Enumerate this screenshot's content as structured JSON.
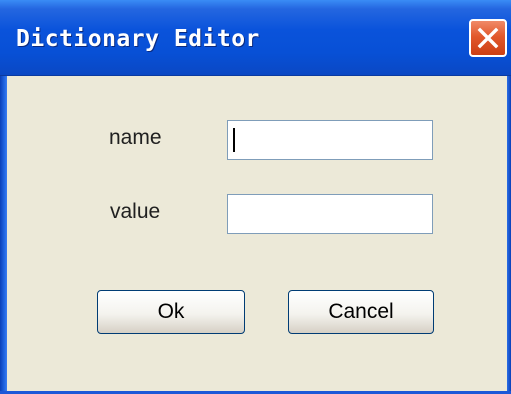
{
  "window": {
    "title": "Dictionary Editor",
    "close_icon": "close-icon"
  },
  "form": {
    "name_label": "name",
    "name_value": "",
    "value_label": "value",
    "value_value": ""
  },
  "buttons": {
    "ok_label": "Ok",
    "cancel_label": "Cancel"
  },
  "colors": {
    "titlebar": "#0a53db",
    "close_button": "#e2582c",
    "dialog_background": "#ece9d8"
  }
}
